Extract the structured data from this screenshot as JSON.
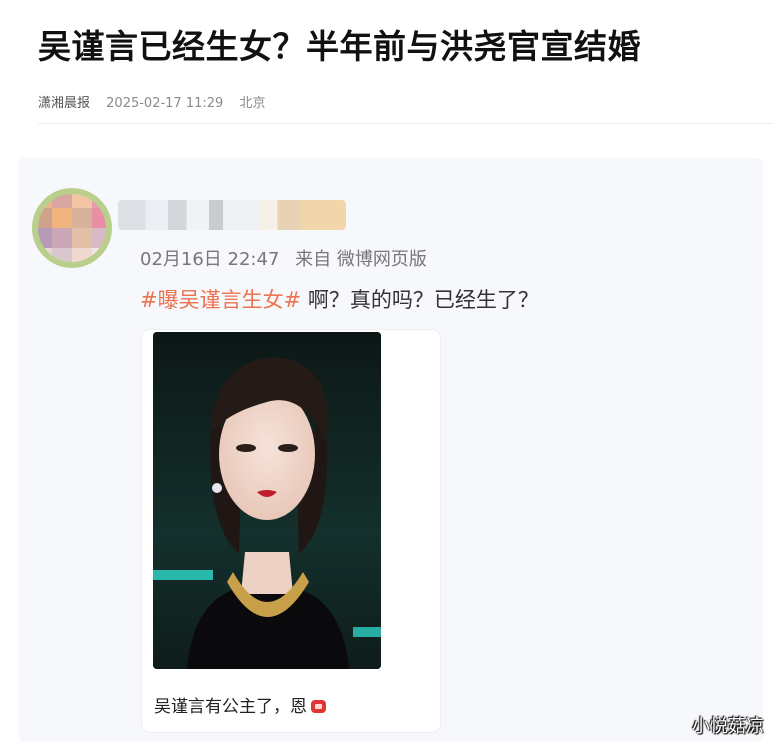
{
  "article": {
    "headline": "吴谨言已经生女？半年前与洪尧官宣结婚",
    "source": "潇湘晨报",
    "datetime": "2025-02-17 11:29",
    "location": "北京"
  },
  "post": {
    "timestamp": "02月16日 22:47",
    "via": "来自 微博网页版",
    "hashtag": "#曝吴谨言生女#",
    "text": " 啊？真的吗？已经生了？",
    "image_caption": "吴谨言有公主了，恩"
  },
  "watermark": "小悦菇凉",
  "colors": {
    "hashtag": "#eb7350",
    "card_background": "#f7f8fb"
  }
}
